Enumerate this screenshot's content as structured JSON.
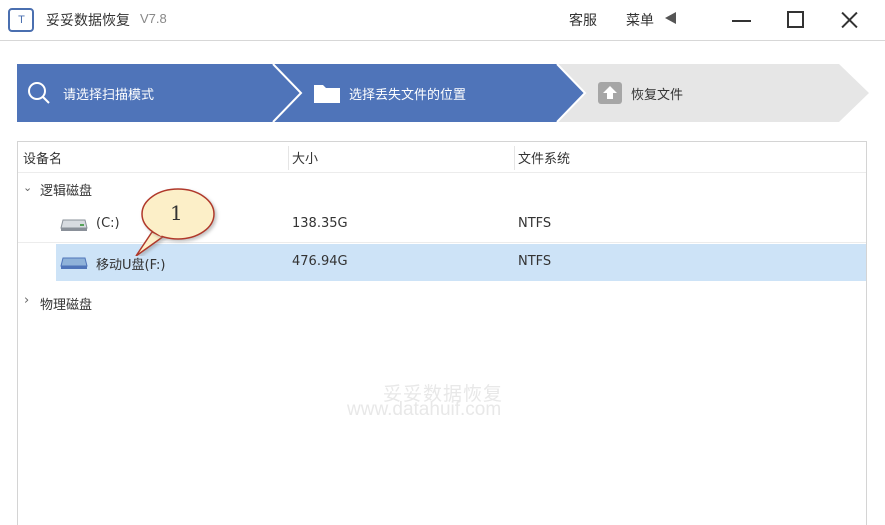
{
  "app": {
    "logo_text": "T",
    "title": "妥妥数据恢复",
    "version": "V7.8"
  },
  "titlebar": {
    "service_label": "客服",
    "menu_label": "菜单"
  },
  "colors": {
    "step_active": "#4f74b9",
    "step_inactive": "#e6e6e6",
    "selected_row": "#cde3f7",
    "callout_fill": "#fcefc8",
    "callout_border": "#b0392a"
  },
  "steps": [
    {
      "label": "请选择扫描模式",
      "icon": "search-icon",
      "state": "active"
    },
    {
      "label": "选择丢失文件的位置",
      "icon": "folder-icon",
      "state": "active"
    },
    {
      "label": "恢复文件",
      "icon": "upload-icon",
      "state": "inactive"
    }
  ],
  "table": {
    "headers": [
      "设备名",
      "大小",
      "文件系统"
    ],
    "groups": [
      {
        "name": "逻辑磁盘",
        "expanded": true,
        "rows": [
          {
            "name": "(C:)",
            "size": "138.35G",
            "fs": "NTFS",
            "selected": false,
            "icon": "hard-drive-icon"
          },
          {
            "name": "移动U盘(F:)",
            "size": "476.94G",
            "fs": "NTFS",
            "selected": true,
            "icon": "usb-drive-icon"
          }
        ]
      },
      {
        "name": "物理磁盘",
        "expanded": false,
        "rows": []
      }
    ]
  },
  "callout": {
    "text": "1"
  },
  "watermark": {
    "text": "妥妥数据恢复",
    "url": "www.datahuif.com"
  }
}
